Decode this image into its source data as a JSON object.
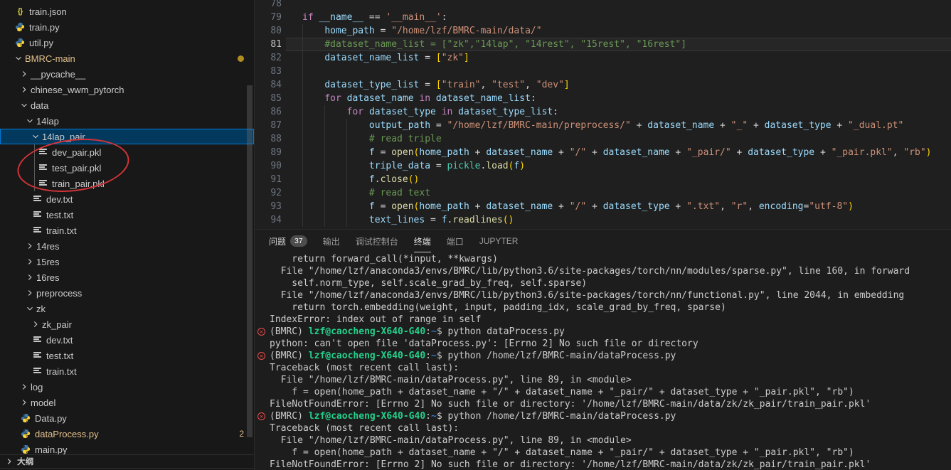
{
  "colors": {
    "accent": "#0078d4",
    "selection_bg": "#04395e",
    "git_modified": "#e2c08d",
    "error_red": "#f14c4c",
    "terminal_green": "#23d18b",
    "terminal_blue": "#3b8eea",
    "annotation_red": "#d13438",
    "badge_bg": "#4d4d4d",
    "syntax": {
      "keyword": "#C586C0",
      "variable": "#9CDCFE",
      "string": "#CE9178",
      "comment": "#6A9955",
      "function": "#DCDCAA",
      "module": "#4EC9B0",
      "punct": "#D4D4D4",
      "bracket": "#FFD700"
    }
  },
  "explorer": {
    "outline_label": "大纲",
    "tree": [
      {
        "label": "train.json",
        "depth": 0,
        "kind": "file",
        "icon": "json"
      },
      {
        "label": "train.py",
        "depth": 0,
        "kind": "file",
        "icon": "py"
      },
      {
        "label": "util.py",
        "depth": 0,
        "kind": "file",
        "icon": "py"
      },
      {
        "label": "BMRC-main",
        "depth": 0,
        "kind": "folder",
        "expanded": true,
        "modified": true,
        "dot": true
      },
      {
        "label": "__pycache__",
        "depth": 1,
        "kind": "folder",
        "expanded": false
      },
      {
        "label": "chinese_wwm_pytorch",
        "depth": 1,
        "kind": "folder",
        "expanded": false
      },
      {
        "label": "data",
        "depth": 1,
        "kind": "folder",
        "expanded": true
      },
      {
        "label": "14lap",
        "depth": 2,
        "kind": "folder",
        "expanded": true
      },
      {
        "label": "14lap_pair",
        "depth": 3,
        "kind": "folder",
        "expanded": true,
        "selected": true
      },
      {
        "label": "dev_pair.pkl",
        "depth": 4,
        "kind": "file",
        "icon": "doc"
      },
      {
        "label": "test_pair.pkl",
        "depth": 4,
        "kind": "file",
        "icon": "doc"
      },
      {
        "label": "train_pair.pkl",
        "depth": 4,
        "kind": "file",
        "icon": "doc"
      },
      {
        "label": "dev.txt",
        "depth": 3,
        "kind": "file",
        "icon": "doc"
      },
      {
        "label": "test.txt",
        "depth": 3,
        "kind": "file",
        "icon": "doc"
      },
      {
        "label": "train.txt",
        "depth": 3,
        "kind": "file",
        "icon": "doc"
      },
      {
        "label": "14res",
        "depth": 2,
        "kind": "folder",
        "expanded": false
      },
      {
        "label": "15res",
        "depth": 2,
        "kind": "folder",
        "expanded": false
      },
      {
        "label": "16res",
        "depth": 2,
        "kind": "folder",
        "expanded": false
      },
      {
        "label": "preprocess",
        "depth": 2,
        "kind": "folder",
        "expanded": false
      },
      {
        "label": "zk",
        "depth": 2,
        "kind": "folder",
        "expanded": true
      },
      {
        "label": "zk_pair",
        "depth": 3,
        "kind": "folder",
        "expanded": false
      },
      {
        "label": "dev.txt",
        "depth": 3,
        "kind": "file",
        "icon": "doc"
      },
      {
        "label": "test.txt",
        "depth": 3,
        "kind": "file",
        "icon": "doc"
      },
      {
        "label": "train.txt",
        "depth": 3,
        "kind": "file",
        "icon": "doc"
      },
      {
        "label": "log",
        "depth": 1,
        "kind": "folder",
        "expanded": false
      },
      {
        "label": "model",
        "depth": 1,
        "kind": "folder",
        "expanded": false
      },
      {
        "label": "Data.py",
        "depth": 1,
        "kind": "file",
        "icon": "py"
      },
      {
        "label": "dataProcess.py",
        "depth": 1,
        "kind": "file",
        "icon": "py",
        "modified": true,
        "badge": "2"
      },
      {
        "label": "main.py",
        "depth": 1,
        "kind": "file",
        "icon": "py"
      }
    ]
  },
  "editor": {
    "first_line": 78,
    "active_line": 81,
    "lines": [
      {
        "num": 78,
        "tokens": []
      },
      {
        "num": 79,
        "tokens": [
          [
            "k",
            "if"
          ],
          [
            "p",
            " "
          ],
          [
            "v",
            "__name__"
          ],
          [
            "p",
            " == "
          ],
          [
            "s",
            "'__main__'"
          ],
          [
            "p",
            ":"
          ]
        ]
      },
      {
        "num": 80,
        "tokens": [
          [
            "p",
            "    "
          ],
          [
            "v",
            "home_path"
          ],
          [
            "p",
            " = "
          ],
          [
            "s",
            "\"/home/lzf/BMRC-main/data/\""
          ]
        ]
      },
      {
        "num": 81,
        "tokens": [
          [
            "p",
            "    "
          ],
          [
            "c",
            "#dataset_name_list = [\"zk\",\"14lap\", \"14rest\", \"15rest\", \"16rest\"]"
          ]
        ]
      },
      {
        "num": 82,
        "tokens": [
          [
            "p",
            "    "
          ],
          [
            "v",
            "dataset_name_list"
          ],
          [
            "p",
            " = "
          ],
          [
            "b",
            "["
          ],
          [
            "s",
            "\"zk\""
          ],
          [
            "b",
            "]"
          ]
        ]
      },
      {
        "num": 83,
        "tokens": []
      },
      {
        "num": 84,
        "tokens": [
          [
            "p",
            "    "
          ],
          [
            "v",
            "dataset_type_list"
          ],
          [
            "p",
            " = "
          ],
          [
            "b",
            "["
          ],
          [
            "s",
            "\"train\""
          ],
          [
            "p",
            ", "
          ],
          [
            "s",
            "\"test\""
          ],
          [
            "p",
            ", "
          ],
          [
            "s",
            "\"dev\""
          ],
          [
            "b",
            "]"
          ]
        ]
      },
      {
        "num": 85,
        "tokens": [
          [
            "p",
            "    "
          ],
          [
            "k",
            "for"
          ],
          [
            "p",
            " "
          ],
          [
            "v",
            "dataset_name"
          ],
          [
            "p",
            " "
          ],
          [
            "k",
            "in"
          ],
          [
            "p",
            " "
          ],
          [
            "v",
            "dataset_name_list"
          ],
          [
            "p",
            ":"
          ]
        ]
      },
      {
        "num": 86,
        "tokens": [
          [
            "p",
            "        "
          ],
          [
            "k",
            "for"
          ],
          [
            "p",
            " "
          ],
          [
            "v",
            "dataset_type"
          ],
          [
            "p",
            " "
          ],
          [
            "k",
            "in"
          ],
          [
            "p",
            " "
          ],
          [
            "v",
            "dataset_type_list"
          ],
          [
            "p",
            ":"
          ]
        ]
      },
      {
        "num": 87,
        "tokens": [
          [
            "p",
            "            "
          ],
          [
            "v",
            "output_path"
          ],
          [
            "p",
            " = "
          ],
          [
            "s",
            "\"/home/lzf/BMRC-main/preprocess/\""
          ],
          [
            "p",
            " + "
          ],
          [
            "v",
            "dataset_name"
          ],
          [
            "p",
            " + "
          ],
          [
            "s",
            "\"_\""
          ],
          [
            "p",
            " + "
          ],
          [
            "v",
            "dataset_type"
          ],
          [
            "p",
            " + "
          ],
          [
            "s",
            "\"_dual.pt\""
          ]
        ]
      },
      {
        "num": 88,
        "tokens": [
          [
            "p",
            "            "
          ],
          [
            "c",
            "# read triple"
          ]
        ]
      },
      {
        "num": 89,
        "tokens": [
          [
            "p",
            "            "
          ],
          [
            "v",
            "f"
          ],
          [
            "p",
            " = "
          ],
          [
            "f",
            "open"
          ],
          [
            "b",
            "("
          ],
          [
            "v",
            "home_path"
          ],
          [
            "p",
            " + "
          ],
          [
            "v",
            "dataset_name"
          ],
          [
            "p",
            " + "
          ],
          [
            "s",
            "\"/\""
          ],
          [
            "p",
            " + "
          ],
          [
            "v",
            "dataset_name"
          ],
          [
            "p",
            " + "
          ],
          [
            "s",
            "\"_pair/\""
          ],
          [
            "p",
            " + "
          ],
          [
            "v",
            "dataset_type"
          ],
          [
            "p",
            " + "
          ],
          [
            "s",
            "\"_pair.pkl\""
          ],
          [
            "p",
            ", "
          ],
          [
            "s",
            "\"rb\""
          ],
          [
            "b",
            ")"
          ]
        ]
      },
      {
        "num": 90,
        "tokens": [
          [
            "p",
            "            "
          ],
          [
            "v",
            "triple_data"
          ],
          [
            "p",
            " = "
          ],
          [
            "m",
            "pickle"
          ],
          [
            "p",
            "."
          ],
          [
            "f",
            "load"
          ],
          [
            "b",
            "("
          ],
          [
            "v",
            "f"
          ],
          [
            "b",
            ")"
          ]
        ]
      },
      {
        "num": 91,
        "tokens": [
          [
            "p",
            "            "
          ],
          [
            "v",
            "f"
          ],
          [
            "p",
            "."
          ],
          [
            "f",
            "close"
          ],
          [
            "b",
            "("
          ],
          [
            "b",
            ")"
          ]
        ]
      },
      {
        "num": 92,
        "tokens": [
          [
            "p",
            "            "
          ],
          [
            "c",
            "# read text"
          ]
        ]
      },
      {
        "num": 93,
        "tokens": [
          [
            "p",
            "            "
          ],
          [
            "v",
            "f"
          ],
          [
            "p",
            " = "
          ],
          [
            "f",
            "open"
          ],
          [
            "b",
            "("
          ],
          [
            "v",
            "home_path"
          ],
          [
            "p",
            " + "
          ],
          [
            "v",
            "dataset_name"
          ],
          [
            "p",
            " + "
          ],
          [
            "s",
            "\"/\""
          ],
          [
            "p",
            " + "
          ],
          [
            "v",
            "dataset_type"
          ],
          [
            "p",
            " + "
          ],
          [
            "s",
            "\".txt\""
          ],
          [
            "p",
            ", "
          ],
          [
            "s",
            "\"r\""
          ],
          [
            "p",
            ", "
          ],
          [
            "v",
            "encoding"
          ],
          [
            "p",
            "="
          ],
          [
            "s",
            "\"utf-8\""
          ],
          [
            "b",
            ")"
          ]
        ]
      },
      {
        "num": 94,
        "tokens": [
          [
            "p",
            "            "
          ],
          [
            "v",
            "text_lines"
          ],
          [
            "p",
            " = "
          ],
          [
            "v",
            "f"
          ],
          [
            "p",
            "."
          ],
          [
            "f",
            "readlines"
          ],
          [
            "b",
            "("
          ],
          [
            "b",
            ")"
          ]
        ]
      }
    ]
  },
  "panel": {
    "tabs": [
      {
        "id": "problems",
        "label": "问题",
        "badge": "37"
      },
      {
        "id": "output",
        "label": "输出"
      },
      {
        "id": "debug-console",
        "label": "调试控制台"
      },
      {
        "id": "terminal",
        "label": "终端",
        "active": true
      },
      {
        "id": "ports",
        "label": "端口"
      },
      {
        "id": "jupyter",
        "label": "JUPYTER"
      }
    ],
    "terminal_rows": [
      {
        "segs": [
          [
            "w",
            "    return forward_call(*input, **kwargs)"
          ]
        ]
      },
      {
        "segs": [
          [
            "w",
            "  File \"/home/lzf/anaconda3/envs/BMRC/lib/python3.6/site-packages/torch/nn/modules/sparse.py\", line 160, in forward"
          ]
        ]
      },
      {
        "segs": [
          [
            "w",
            "    self.norm_type, self.scale_grad_by_freq, self.sparse)"
          ]
        ]
      },
      {
        "segs": [
          [
            "w",
            "  File \"/home/lzf/anaconda3/envs/BMRC/lib/python3.6/site-packages/torch/nn/functional.py\", line 2044, in embedding"
          ]
        ]
      },
      {
        "segs": [
          [
            "w",
            "    return torch.embedding(weight, input, padding_idx, scale_grad_by_freq, sparse)"
          ]
        ]
      },
      {
        "segs": [
          [
            "w",
            "IndexError: index out of range in self"
          ]
        ]
      },
      {
        "err": true,
        "segs": [
          [
            "w",
            "(BMRC) "
          ],
          [
            "g",
            "lzf@caocheng-X640-G40"
          ],
          [
            "w",
            ":"
          ],
          [
            "b",
            "~"
          ],
          [
            "w",
            "$ python dataProcess.py"
          ]
        ]
      },
      {
        "segs": [
          [
            "w",
            "python: can't open file 'dataProcess.py': [Errno 2] No such file or directory"
          ]
        ]
      },
      {
        "err": true,
        "segs": [
          [
            "w",
            "(BMRC) "
          ],
          [
            "g",
            "lzf@caocheng-X640-G40"
          ],
          [
            "w",
            ":"
          ],
          [
            "b",
            "~"
          ],
          [
            "w",
            "$ python /home/lzf/BMRC-main/dataProcess.py"
          ]
        ]
      },
      {
        "segs": [
          [
            "w",
            "Traceback (most recent call last):"
          ]
        ]
      },
      {
        "segs": [
          [
            "w",
            "  File \"/home/lzf/BMRC-main/dataProcess.py\", line 89, in <module>"
          ]
        ]
      },
      {
        "segs": [
          [
            "w",
            "    f = open(home_path + dataset_name + \"/\" + dataset_name + \"_pair/\" + dataset_type + \"_pair.pkl\", \"rb\")"
          ]
        ]
      },
      {
        "segs": [
          [
            "w",
            "FileNotFoundError: [Errno 2] No such file or directory: '/home/lzf/BMRC-main/data/zk/zk_pair/train_pair.pkl'"
          ]
        ]
      },
      {
        "err": true,
        "segs": [
          [
            "w",
            "(BMRC) "
          ],
          [
            "g",
            "lzf@caocheng-X640-G40"
          ],
          [
            "w",
            ":"
          ],
          [
            "b",
            "~"
          ],
          [
            "w",
            "$ python /home/lzf/BMRC-main/dataProcess.py"
          ]
        ]
      },
      {
        "segs": [
          [
            "w",
            "Traceback (most recent call last):"
          ]
        ]
      },
      {
        "segs": [
          [
            "w",
            "  File \"/home/lzf/BMRC-main/dataProcess.py\", line 89, in <module>"
          ]
        ]
      },
      {
        "segs": [
          [
            "w",
            "    f = open(home_path + dataset_name + \"/\" + dataset_name + \"_pair/\" + dataset_type + \"_pair.pkl\", \"rb\")"
          ]
        ]
      },
      {
        "segs": [
          [
            "w",
            "FileNotFoundError: [Errno 2] No such file or directory: '/home/lzf/BMRC-main/data/zk/zk_pair/train_pair.pkl'"
          ]
        ]
      }
    ]
  }
}
